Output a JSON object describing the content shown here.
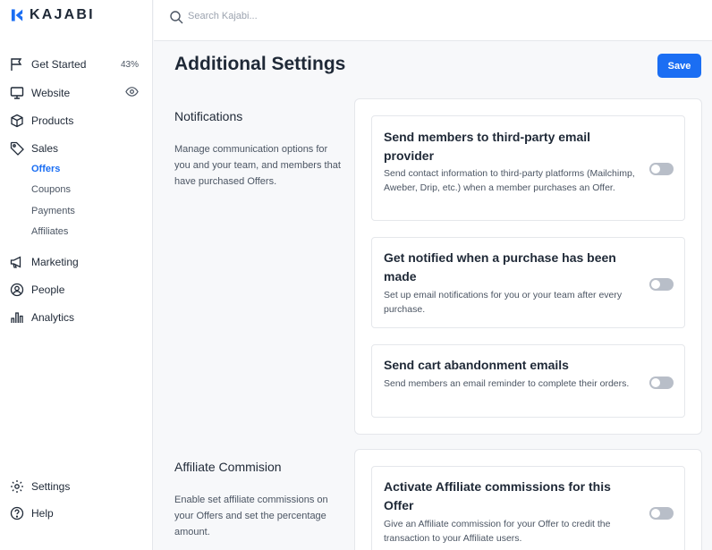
{
  "brand": {
    "name": "KAJABI",
    "accent": "#1b6ef3"
  },
  "search": {
    "placeholder": "Search Kajabi..."
  },
  "sidebar": {
    "items": [
      {
        "label": "Get Started",
        "icon": "flag-icon",
        "badge": "43%"
      },
      {
        "label": "Website",
        "icon": "monitor-icon",
        "right_icon": "eye-icon"
      },
      {
        "label": "Products",
        "icon": "box-icon"
      },
      {
        "label": "Sales",
        "icon": "tag-icon"
      },
      {
        "label": "Marketing",
        "icon": "megaphone-icon"
      },
      {
        "label": "People",
        "icon": "user-circle-icon"
      },
      {
        "label": "Analytics",
        "icon": "bar-chart-icon"
      }
    ],
    "sales_sub": [
      "Offers",
      "Coupons",
      "Payments",
      "Affiliates"
    ],
    "active_sub": "Offers",
    "footer": [
      {
        "label": "Settings",
        "icon": "gear-icon"
      },
      {
        "label": "Help",
        "icon": "help-circle-icon"
      }
    ]
  },
  "main": {
    "title": "Additional Settings",
    "save_label": "Save",
    "sections": [
      {
        "title": "Notifications",
        "description": "Manage communication options for you and your team, and members that have purchased Offers.",
        "settings": [
          {
            "title": "Send members to third-party email provider",
            "description": "Send contact information to third-party platforms (Mailchimp, Aweber, Drip, etc.) when a member purchases an Offer.",
            "enabled": false
          },
          {
            "title": "Get notified when a purchase has been made",
            "description": "Set up email notifications for you or your team after every purchase.",
            "enabled": false
          },
          {
            "title": "Send cart abandonment emails",
            "description": "Send members an email reminder to complete their orders.",
            "enabled": false
          }
        ]
      },
      {
        "title": "Affiliate Commision",
        "description": "Enable set affiliate commissions on your Offers and set the percentage amount.",
        "settings": [
          {
            "title": "Activate Affiliate commissions for this Offer",
            "description": "Give an Affiliate commission for your Offer to credit the transaction to your Affiliate users.",
            "enabled": false
          }
        ]
      }
    ]
  }
}
